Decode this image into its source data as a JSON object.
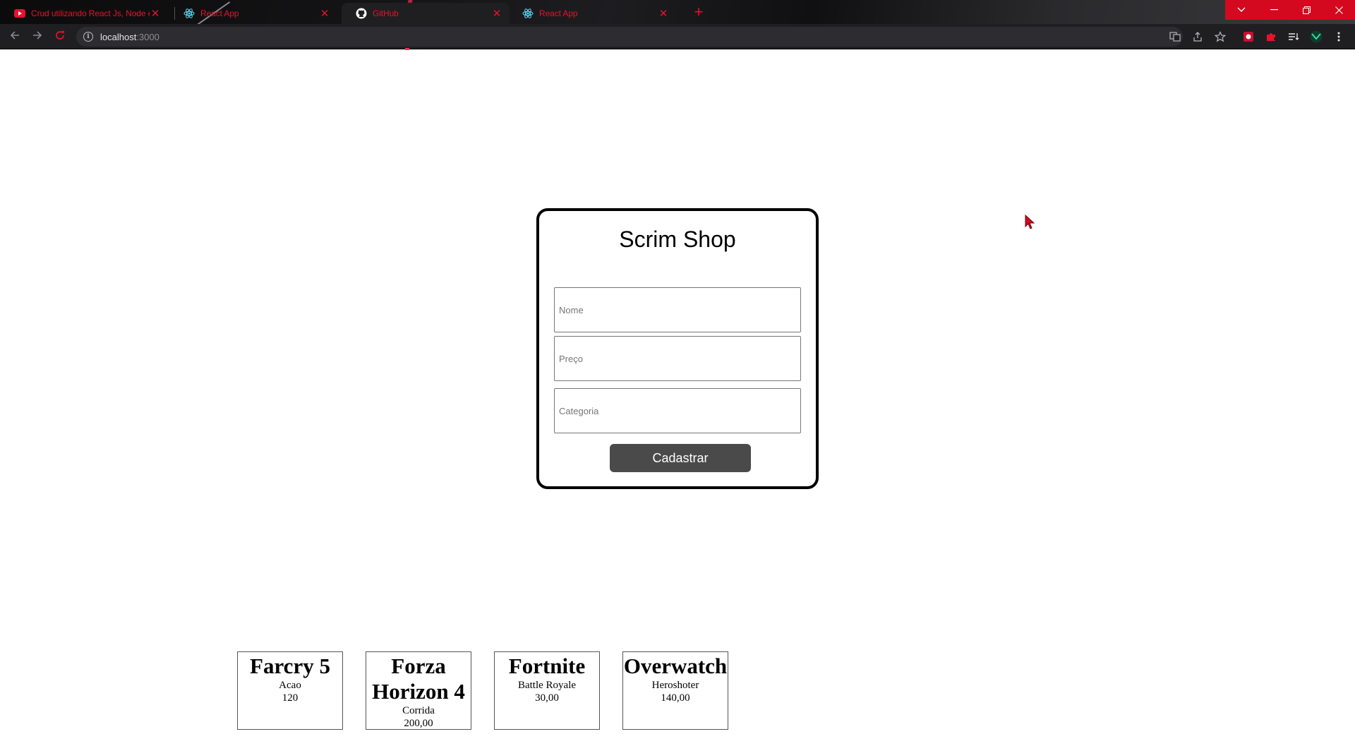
{
  "browser": {
    "tabs": [
      {
        "title": "Crud utilizando React Js, Node e",
        "icon": "youtube-icon",
        "active": false
      },
      {
        "title": "React App",
        "icon": "react-icon",
        "active": false
      },
      {
        "title": "GitHub",
        "icon": "github-icon",
        "active": true
      },
      {
        "title": "React App",
        "icon": "react-icon",
        "active": false
      }
    ],
    "new_tab_label": "+",
    "address": {
      "host": "localhost",
      "port": ":3000"
    },
    "accent_color": "#e8112d"
  },
  "page": {
    "title": "Scrim Shop",
    "form": {
      "name_placeholder": "Nome",
      "price_placeholder": "Preço",
      "category_placeholder": "Categoria",
      "submit_label": "Cadastrar"
    },
    "products": [
      {
        "name": "Farcry 5",
        "category": "Acao",
        "price": "120"
      },
      {
        "name": "Forza Horizon 4",
        "category": "Corrida",
        "price": "200,00"
      },
      {
        "name": "Fortnite",
        "category": "Battle Royale",
        "price": "30,00"
      },
      {
        "name": "Overwatch",
        "category": "Heroshoter",
        "price": "140,00"
      }
    ]
  }
}
